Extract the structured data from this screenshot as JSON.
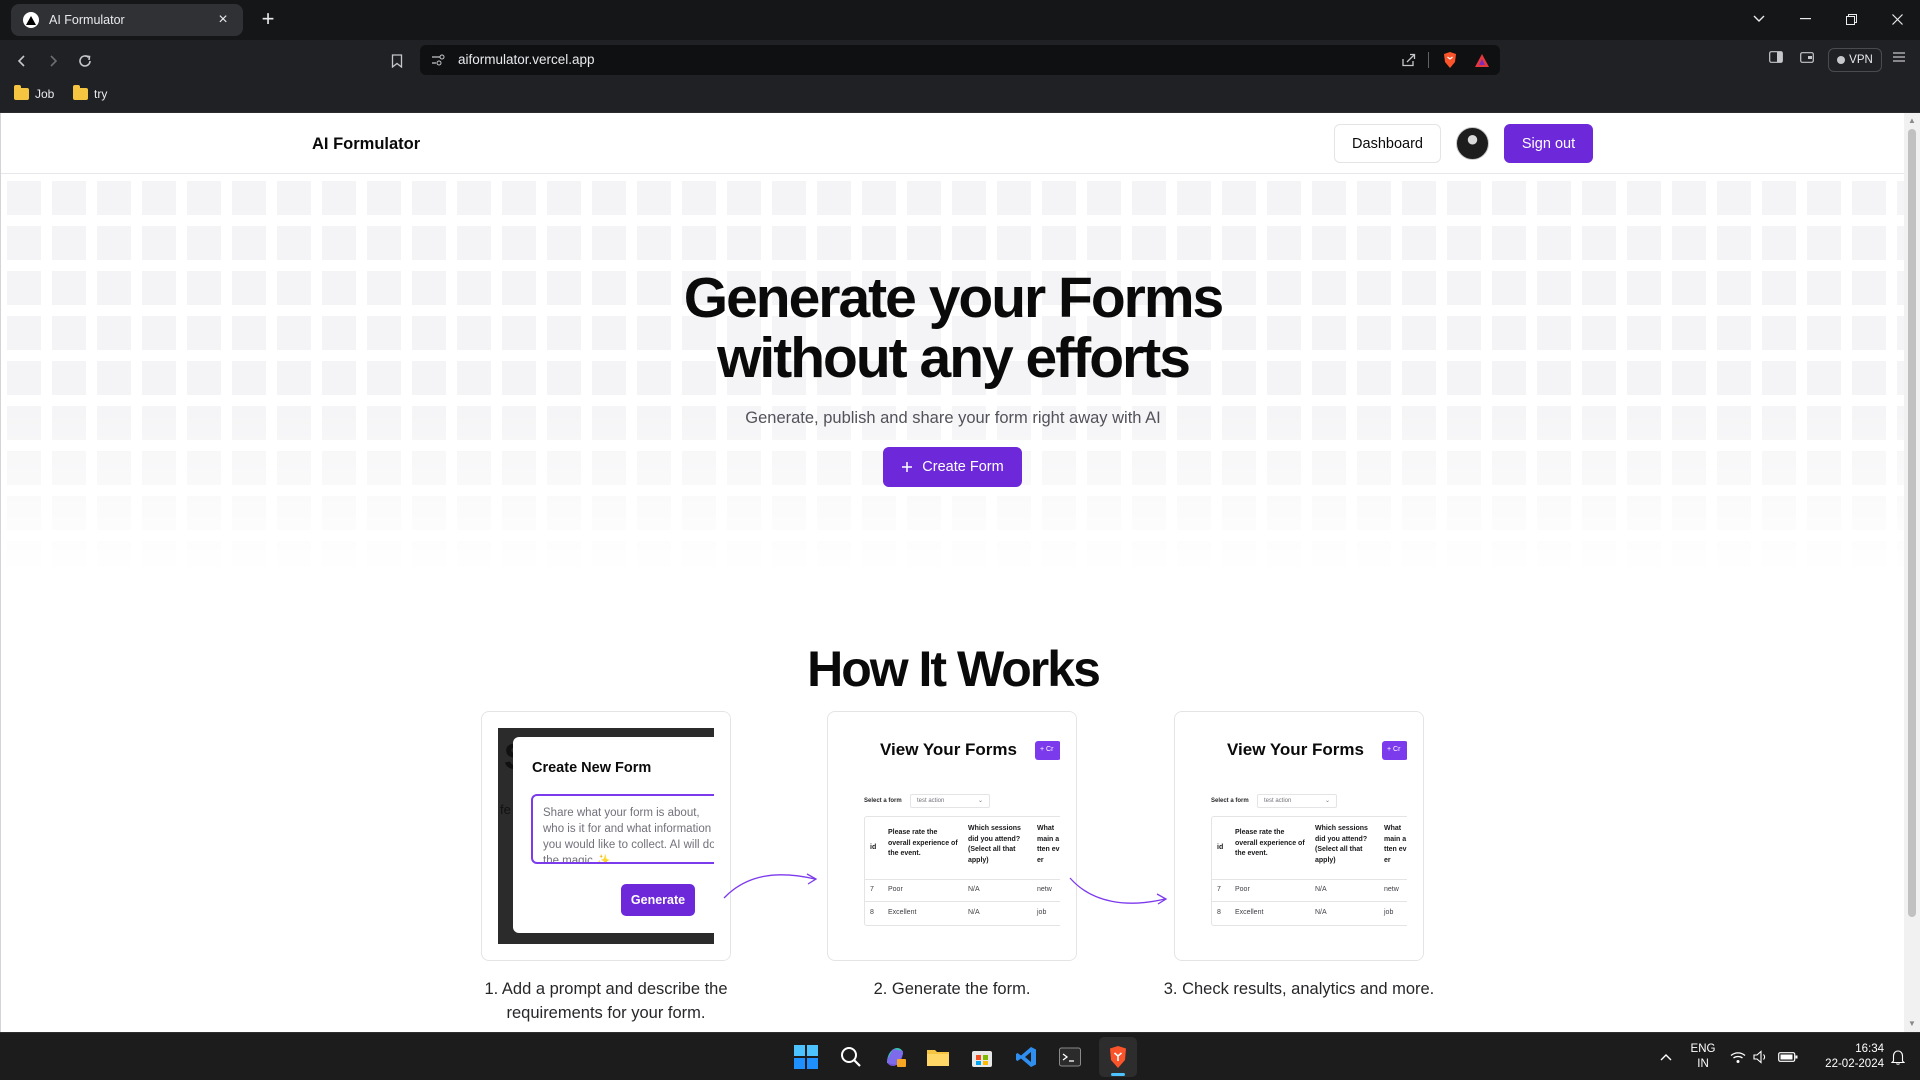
{
  "browser": {
    "tab_title": "AI Formulator",
    "tab_close": "×",
    "new_tab": "+",
    "url": "aiformulator.vercel.app",
    "vpn_label": "VPN",
    "bookmarks": [
      {
        "label": "Job",
        "icon": "folder-icon"
      },
      {
        "label": "try",
        "icon": "folder-icon"
      }
    ],
    "accent": "#202124"
  },
  "site": {
    "brand": "AI Formulator",
    "dashboard_label": "Dashboard",
    "signout_label": "Sign out",
    "accent_color": "#6d28d9"
  },
  "hero": {
    "title_line1": "Generate your Forms",
    "title_line2": "without any efforts",
    "subtitle": "Generate, publish and share your form right away with AI",
    "cta_label": "Create Form",
    "cta_icon": "plus-icon"
  },
  "how_it_works": {
    "title": "How It Works",
    "steps": [
      {
        "caption_line1": "1. Add a prompt and describe the",
        "caption_line2": "requirements for your form.",
        "preview": {
          "bg_text_big": "S",
          "bg_text_small": "fe",
          "modal_title": "Create New Form",
          "textarea_placeholder": "Share what your form is about, who is it for and what information you would like to collect. AI will do the magic ✨",
          "button_label": "Generate"
        }
      },
      {
        "caption_line1": "2. Generate the form.",
        "preview": {
          "title": "View Your Forms",
          "button_label": "+ Cr",
          "select_label": "Select a form",
          "select_value": "test action",
          "columns": [
            "id",
            "Please rate the overall experience of the event.",
            "Which sessions did you attend? (Select all that apply)",
            "What main atten ever"
          ],
          "rows": [
            [
              "7",
              "Poor",
              "N/A",
              "netw"
            ],
            [
              "8",
              "Excellent",
              "N/A",
              "job"
            ]
          ]
        }
      },
      {
        "caption_line1": "3. Check results, analytics and more.",
        "preview": {
          "title": "View Your Forms",
          "button_label": "+ Cr",
          "select_label": "Select a form",
          "select_value": "test action",
          "columns": [
            "id",
            "Please rate the overall experience of the event.",
            "Which sessions did you attend? (Select all that apply)",
            "What main atten ever"
          ],
          "rows": [
            [
              "7",
              "Poor",
              "N/A",
              "netw"
            ],
            [
              "8",
              "Excellent",
              "N/A",
              "job"
            ]
          ]
        }
      }
    ]
  },
  "taskbar": {
    "apps": [
      "windows-start-icon",
      "search-icon",
      "copilot-icon",
      "file-explorer-icon",
      "microsoft-store-icon",
      "vscode-icon",
      "terminal-icon",
      "brave-browser-icon"
    ],
    "language_line1": "ENG",
    "language_line2": "IN",
    "time": "16:34",
    "date": "22-02-2024"
  }
}
